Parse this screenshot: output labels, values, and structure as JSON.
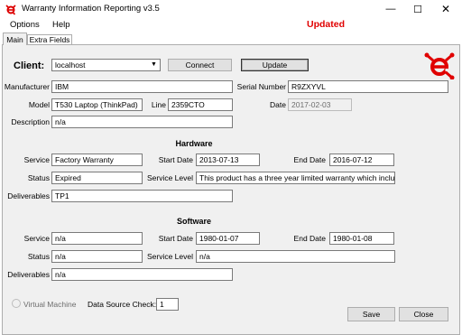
{
  "window": {
    "title": "Warranty Information Reporting v3.5",
    "controls": {
      "minimize": "—",
      "maximize": "☐",
      "close": "✕"
    },
    "status": "Updated"
  },
  "menu": {
    "options": "Options",
    "help": "Help"
  },
  "tabs": [
    "Main",
    "Extra Fields"
  ],
  "client": {
    "label": "Client:",
    "value": "localhost",
    "connect": "Connect",
    "update": "Update"
  },
  "device": {
    "manufacturer_label": "Manufacturer",
    "manufacturer": "IBM",
    "model_label": "Model",
    "model": "T530 Laptop (ThinkPad)",
    "line_label": "Line",
    "line": "2359CTO",
    "description_label": "Description",
    "description": "n/a",
    "serial_label": "Serial Number",
    "serial": "R9ZXYVL",
    "date_label": "Date",
    "date": "2017-02-03"
  },
  "hardware": {
    "heading": "Hardware",
    "service_label": "Service",
    "service": "Factory Warranty",
    "start_label": "Start Date",
    "start": "2013-07-13",
    "end_label": "End Date",
    "end": "2016-07-12",
    "status_label": "Status",
    "status": "Expired",
    "level_label": "Service Level",
    "level": "This product has a three year limited warranty which includes a w",
    "deliverables_label": "Deliverables",
    "deliverables": "TP1"
  },
  "software": {
    "heading": "Software",
    "service_label": "Service",
    "service": "n/a",
    "start_label": "Start Date",
    "start": "1980-01-07",
    "end_label": "End Date",
    "end": "1980-01-08",
    "status_label": "Status",
    "status": "n/a",
    "level_label": "Service Level",
    "level": "n/a",
    "deliverables_label": "Deliverables",
    "deliverables": "n/a"
  },
  "footer": {
    "virtual_machine": "Virtual Machine",
    "data_source_label": "Data Source Check:",
    "data_source": "1",
    "save": "Save",
    "close": "Close"
  },
  "colors": {
    "accent_red": "#e00000",
    "panel_bg": "#f0f0f0"
  }
}
